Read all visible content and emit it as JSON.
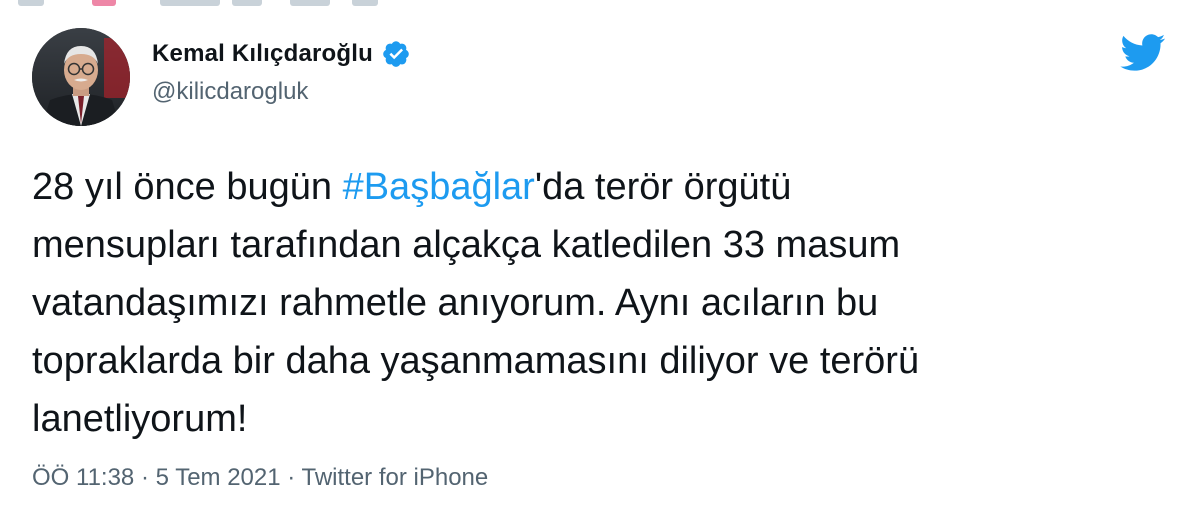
{
  "header": {
    "display_name": "Kemal Kılıçdaroğlu",
    "handle": "@kilicdarogluk",
    "verified_icon": "verified-badge-icon",
    "logo_icon": "twitter-bird-icon"
  },
  "tweet": {
    "part1": "28 yıl önce bugün ",
    "hashtag": "#Başbağlar",
    "part2": "'da terör örgütü\nmensupları tarafından alçakça katledilen 33 masum\nvatandaşımızı rahmetle anıyorum. Aynı acıların bu\ntopraklarda bir daha yaşanmamasını diliyor ve terörü\nlanetliyorum!"
  },
  "meta": {
    "time": "ÖÖ 11:38",
    "separator1": " · ",
    "date": "5 Tem 2021",
    "separator2": " · ",
    "source": "Twitter for iPhone"
  },
  "colors": {
    "accent": "#1d9bf0",
    "text": "#0f1419",
    "secondary": "#536471"
  }
}
